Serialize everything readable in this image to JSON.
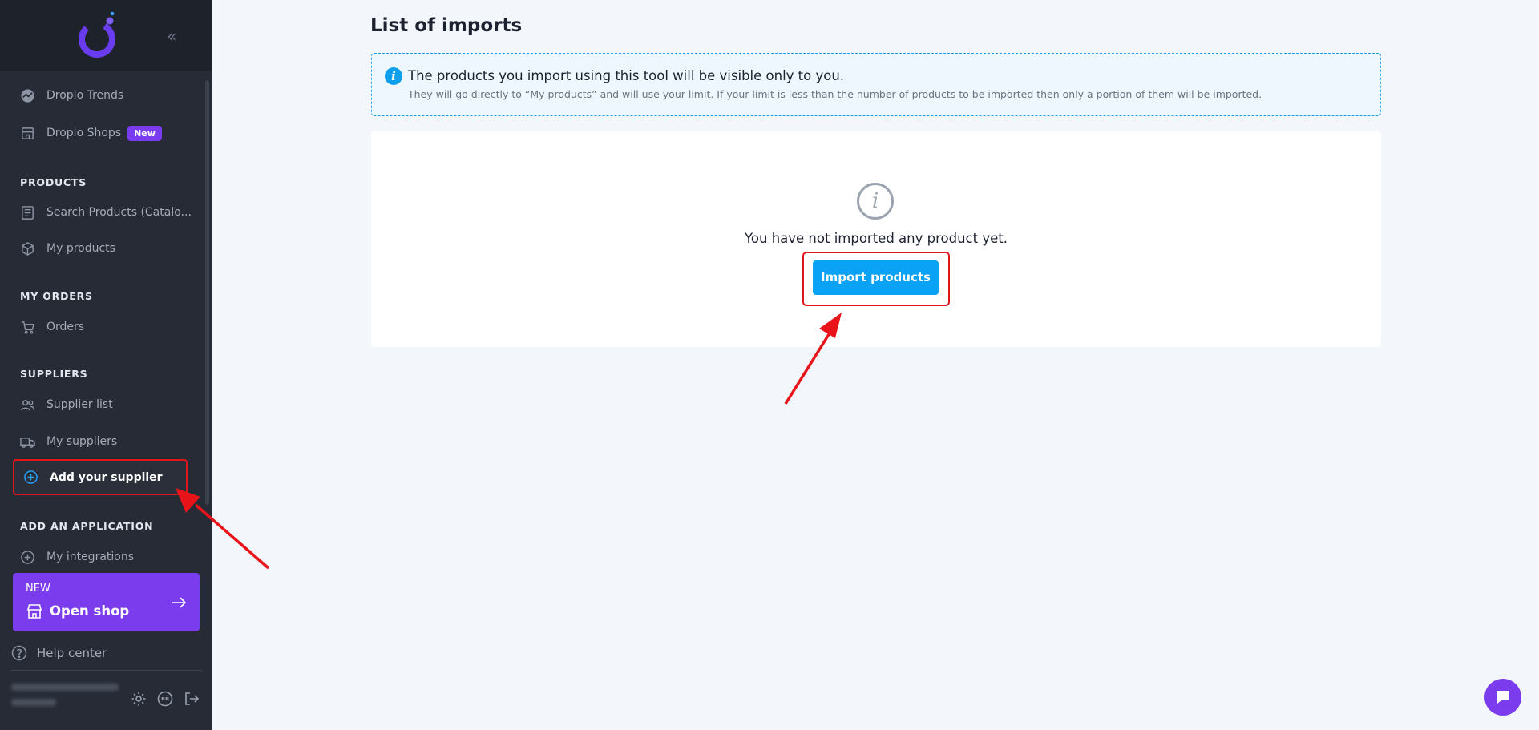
{
  "sidebar": {
    "collapse_glyph": "«",
    "top_items": [
      {
        "label": "Droplo Trends",
        "icon": "trend-icon"
      },
      {
        "label": "Droplo Shops",
        "icon": "store-icon",
        "badge": "New"
      }
    ],
    "sections": [
      {
        "title": "PRODUCTS",
        "items": [
          {
            "label": "Search Products (Catalo...",
            "icon": "catalog-icon"
          },
          {
            "label": "My products",
            "icon": "box-icon"
          }
        ]
      },
      {
        "title": "MY ORDERS",
        "items": [
          {
            "label": "Orders",
            "icon": "cart-icon"
          }
        ]
      },
      {
        "title": "SUPPLIERS",
        "items": [
          {
            "label": "Supplier list",
            "icon": "users-icon"
          },
          {
            "label": "My suppliers",
            "icon": "truck-icon"
          },
          {
            "label": "Add your supplier",
            "icon": "plus-circle-icon",
            "highlighted": true
          }
        ]
      },
      {
        "title": "ADD AN APPLICATION",
        "items": [
          {
            "label": "My integrations",
            "icon": "plus-circle-icon"
          }
        ]
      }
    ],
    "open_shop": {
      "tag": "NEW",
      "label": "Open shop",
      "arrow": "→"
    },
    "help_label": "Help center",
    "footer_icons": [
      "gear-icon",
      "chat-quote-icon",
      "logout-icon"
    ]
  },
  "main": {
    "title": "List of imports",
    "info": {
      "icon_glyph": "i",
      "title": "The products you import using this tool will be visible only to you.",
      "text": "They will go directly to “My products” and will use your limit. If your limit is less than the number of products to be imported then only a portion of them will be imported."
    },
    "empty_state": {
      "icon_glyph": "i",
      "message": "You have not imported any product yet.",
      "button_label": "Import products"
    }
  },
  "colors": {
    "sidebar_bg": "#262b36",
    "accent_purple": "#7b3cee",
    "accent_blue": "#0aa2f4",
    "highlight_red": "#e0161c"
  }
}
